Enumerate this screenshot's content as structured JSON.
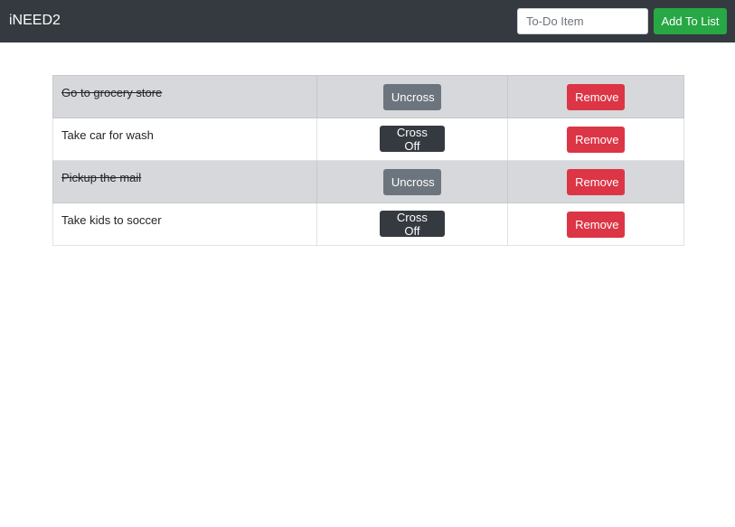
{
  "navbar": {
    "brand": "iNEED2",
    "input_placeholder": "To-Do Item",
    "add_label": "Add To List"
  },
  "todos": [
    {
      "text": "Go to grocery store",
      "crossed": true,
      "toggle_label": "Uncross",
      "remove_label": "Remove"
    },
    {
      "text": "Take car for wash",
      "crossed": false,
      "toggle_label": "Cross Off",
      "remove_label": "Remove"
    },
    {
      "text": "Pickup the mail",
      "crossed": true,
      "toggle_label": "Uncross",
      "remove_label": "Remove"
    },
    {
      "text": "Take kids to soccer",
      "crossed": false,
      "toggle_label": "Cross Off",
      "remove_label": "Remove"
    }
  ],
  "colors": {
    "navbar": "#343a40",
    "add_button": "#28a745",
    "uncross_button": "#6c757d",
    "crossoff_button": "#343a40",
    "remove_button": "#dc3545",
    "crossed_row": "#d6d8db"
  }
}
